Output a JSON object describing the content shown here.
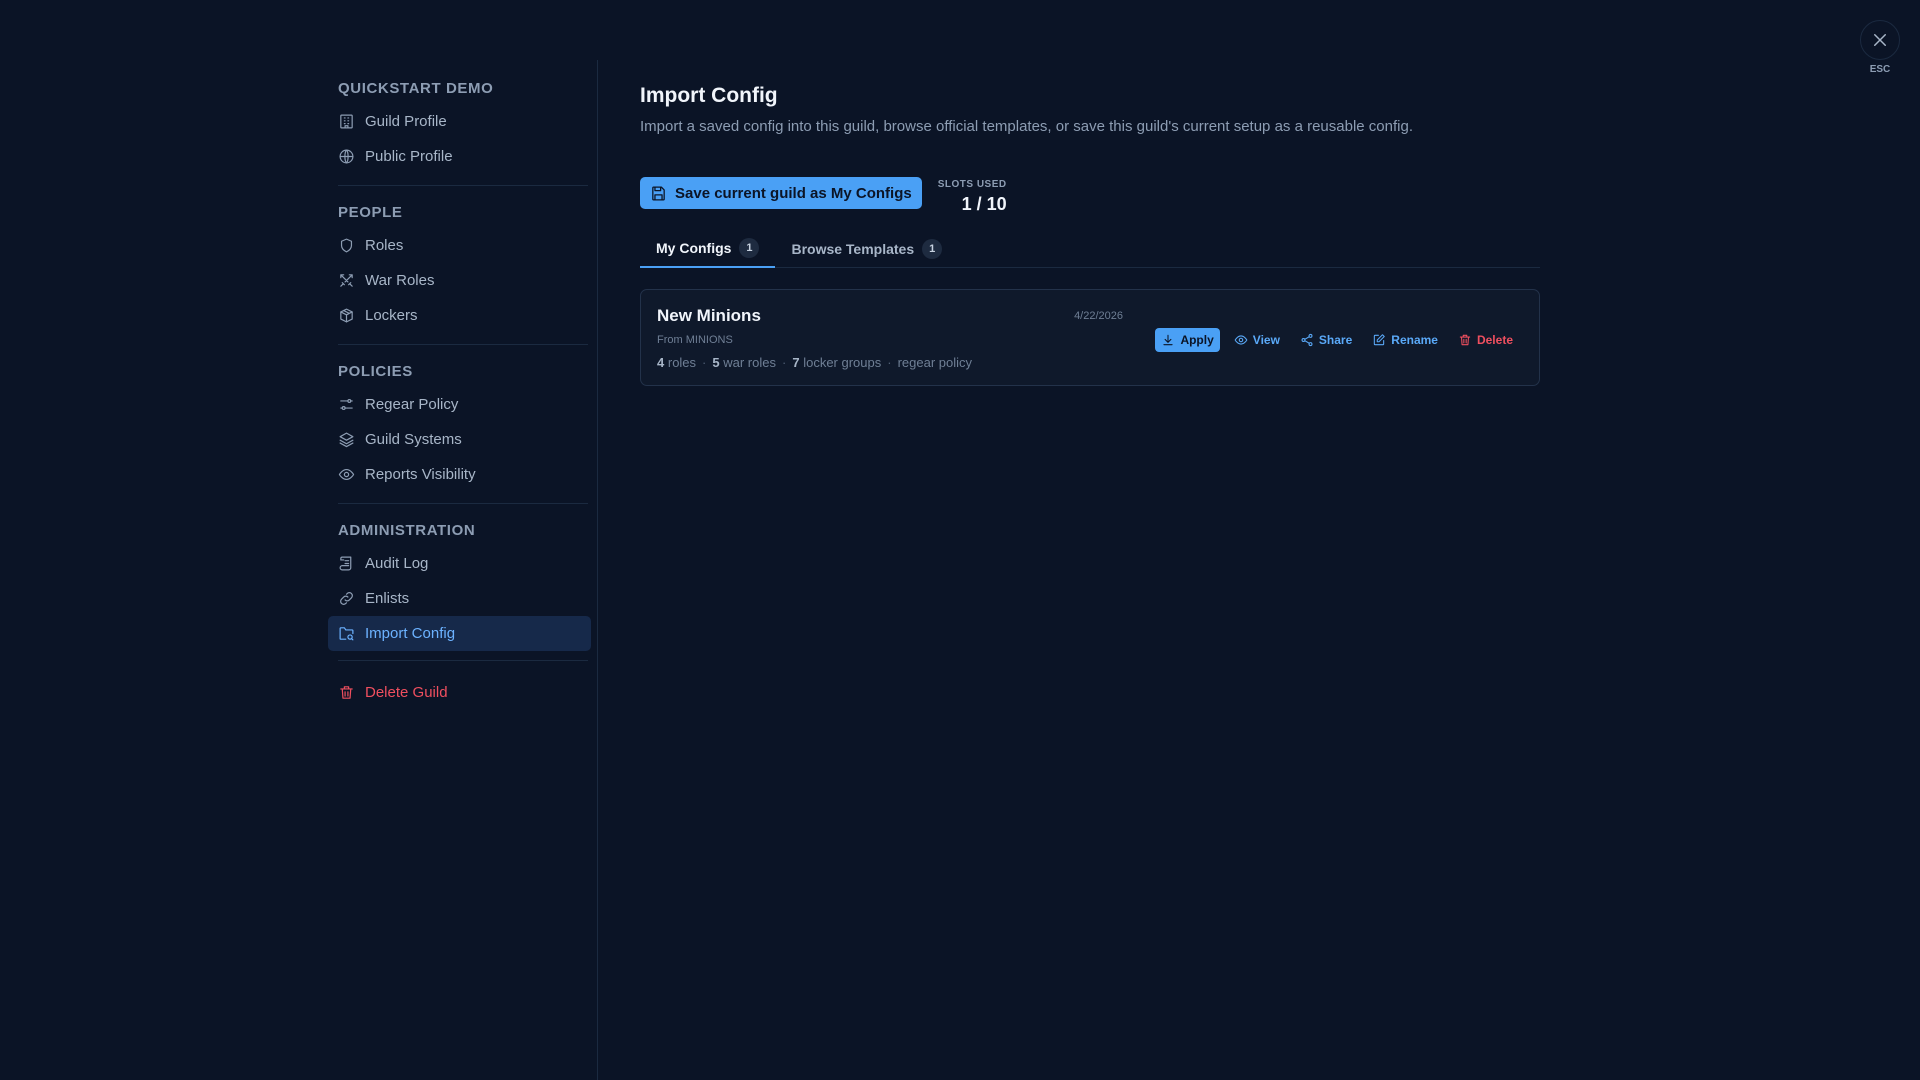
{
  "sidebar": {
    "sections": [
      {
        "title": "QUICKSTART DEMO",
        "items": [
          {
            "label": "Guild Profile",
            "icon": "building-icon"
          },
          {
            "label": "Public Profile",
            "icon": "globe-icon"
          }
        ]
      },
      {
        "title": "PEOPLE",
        "items": [
          {
            "label": "Roles",
            "icon": "shield-icon"
          },
          {
            "label": "War Roles",
            "icon": "crossed-swords-icon"
          },
          {
            "label": "Lockers",
            "icon": "package-icon"
          }
        ]
      },
      {
        "title": "POLICIES",
        "items": [
          {
            "label": "Regear Policy",
            "icon": "sliders-icon"
          },
          {
            "label": "Guild Systems",
            "icon": "layers-icon"
          },
          {
            "label": "Reports Visibility",
            "icon": "eye-icon"
          }
        ]
      },
      {
        "title": "ADMINISTRATION",
        "items": [
          {
            "label": "Audit Log",
            "icon": "scroll-icon"
          },
          {
            "label": "Enlists",
            "icon": "link-icon"
          },
          {
            "label": "Import Config",
            "icon": "folder-search-icon",
            "active": true
          }
        ]
      }
    ],
    "delete_label": "Delete Guild"
  },
  "main": {
    "title": "Import Config",
    "description": "Import a saved config into this guild, browse official templates, or save this guild's current setup as a reusable config.",
    "save_button": "Save current guild as My Configs",
    "slots_label": "SLOTS USED",
    "slots_value": "1 / 10",
    "tabs": [
      {
        "label": "My Configs",
        "count": "1"
      },
      {
        "label": "Browse Templates",
        "count": "1"
      }
    ],
    "config": {
      "name": "New Minions",
      "from": "From MINIONS",
      "date": "4/22/2026",
      "roles_count": "4",
      "roles_label": "roles",
      "war_roles_count": "5",
      "war_roles_label": "war roles",
      "locker_count": "7",
      "locker_label": "locker groups",
      "policy_label": "regear policy",
      "actions": {
        "apply": "Apply",
        "view": "View",
        "share": "Share",
        "rename": "Rename",
        "delete": "Delete"
      }
    }
  },
  "close_label": "ESC",
  "colors": {
    "background": "#0b1426",
    "accent": "#4aa0f5",
    "danger": "#ef4f5f",
    "active_bg": "#16294a"
  }
}
